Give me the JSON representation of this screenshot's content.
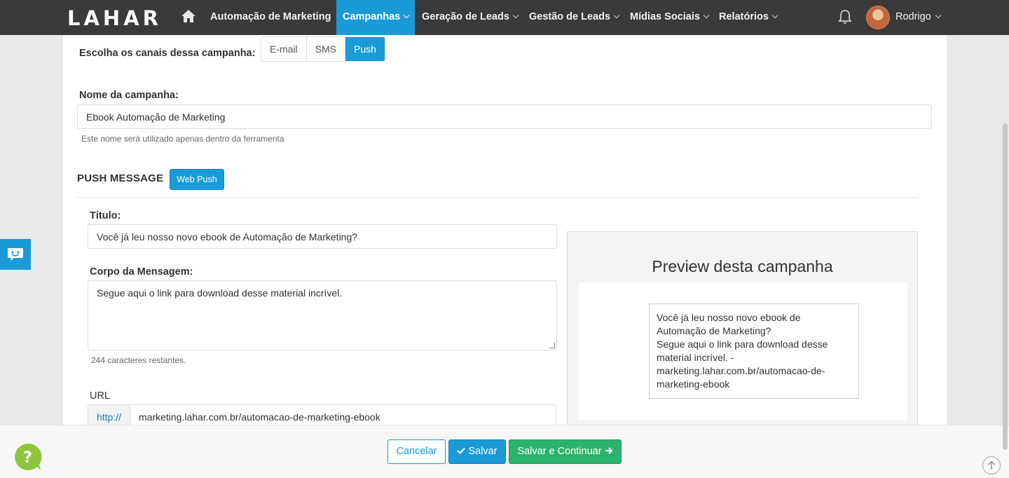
{
  "header": {
    "logo": "LAHAR",
    "nav": [
      {
        "label": "Automação de Marketing"
      },
      {
        "label": "Campanhas"
      },
      {
        "label": "Geração de Leads"
      },
      {
        "label": "Gestão de Leads"
      },
      {
        "label": "Mídias Sociais"
      },
      {
        "label": "Relatórios"
      }
    ],
    "user_name": "Rodrigo",
    "accent_color": "#1a9bd7"
  },
  "channels": {
    "label": "Escolha os canais dessa campanha:",
    "options": [
      "E-mail",
      "SMS",
      "Push"
    ],
    "selected": "Push"
  },
  "campaign": {
    "name_label": "Nome da campanha:",
    "name_value": "Ebook Automação de Marketing",
    "name_help": "Este nome será utilizado apenas dentro da ferramenta"
  },
  "push": {
    "section_title": "PUSH MESSAGE",
    "type_button": "Web Push",
    "title_label": "Título:",
    "title_value": "Você já leu nosso novo ebook de Automação de Marketing?",
    "body_label": "Corpo da Mensagem:",
    "body_value": "Segue aqui o link para download desse material incrível.",
    "chars_remaining": "244 caracteres restantes.",
    "url_label": "URL",
    "url_prefix": "http://",
    "url_value": "marketing.lahar.com.br/automacao-de-marketing-ebook"
  },
  "preview": {
    "title": "Preview desta campanha",
    "line1": "Você já leu nosso novo ebook de",
    "line2": "Automação de Marketing?",
    "line3": "Segue aqui o link para download desse",
    "line4": "material incrível. -",
    "line5": "marketing.lahar.com.br/automacao-de-",
    "line6": "marketing-ebook"
  },
  "footer": {
    "cancel": "Cancelar",
    "save": "Salvar",
    "save_continue": "Salvar e Continuar",
    "save_color": "#1a9bd7",
    "continue_color": "#2bb36b"
  },
  "icons": {
    "home": "home-icon",
    "bell": "bell-icon",
    "chat": "chat-icon",
    "help": "help-icon",
    "check": "check-icon",
    "arrow": "arrow-right-icon",
    "scroll_top": "arrow-up-icon"
  }
}
